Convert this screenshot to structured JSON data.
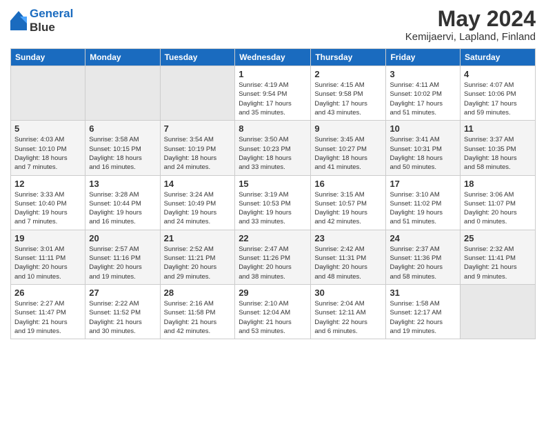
{
  "logo": {
    "line1": "General",
    "line2": "Blue"
  },
  "title": "May 2024",
  "subtitle": "Kemijaervi, Lapland, Finland",
  "weekdays": [
    "Sunday",
    "Monday",
    "Tuesday",
    "Wednesday",
    "Thursday",
    "Friday",
    "Saturday"
  ],
  "weeks": [
    [
      {
        "day": "",
        "info": ""
      },
      {
        "day": "",
        "info": ""
      },
      {
        "day": "",
        "info": ""
      },
      {
        "day": "1",
        "info": "Sunrise: 4:19 AM\nSunset: 9:54 PM\nDaylight: 17 hours\nand 35 minutes."
      },
      {
        "day": "2",
        "info": "Sunrise: 4:15 AM\nSunset: 9:58 PM\nDaylight: 17 hours\nand 43 minutes."
      },
      {
        "day": "3",
        "info": "Sunrise: 4:11 AM\nSunset: 10:02 PM\nDaylight: 17 hours\nand 51 minutes."
      },
      {
        "day": "4",
        "info": "Sunrise: 4:07 AM\nSunset: 10:06 PM\nDaylight: 17 hours\nand 59 minutes."
      }
    ],
    [
      {
        "day": "5",
        "info": "Sunrise: 4:03 AM\nSunset: 10:10 PM\nDaylight: 18 hours\nand 7 minutes."
      },
      {
        "day": "6",
        "info": "Sunrise: 3:58 AM\nSunset: 10:15 PM\nDaylight: 18 hours\nand 16 minutes."
      },
      {
        "day": "7",
        "info": "Sunrise: 3:54 AM\nSunset: 10:19 PM\nDaylight: 18 hours\nand 24 minutes."
      },
      {
        "day": "8",
        "info": "Sunrise: 3:50 AM\nSunset: 10:23 PM\nDaylight: 18 hours\nand 33 minutes."
      },
      {
        "day": "9",
        "info": "Sunrise: 3:45 AM\nSunset: 10:27 PM\nDaylight: 18 hours\nand 41 minutes."
      },
      {
        "day": "10",
        "info": "Sunrise: 3:41 AM\nSunset: 10:31 PM\nDaylight: 18 hours\nand 50 minutes."
      },
      {
        "day": "11",
        "info": "Sunrise: 3:37 AM\nSunset: 10:35 PM\nDaylight: 18 hours\nand 58 minutes."
      }
    ],
    [
      {
        "day": "12",
        "info": "Sunrise: 3:33 AM\nSunset: 10:40 PM\nDaylight: 19 hours\nand 7 minutes."
      },
      {
        "day": "13",
        "info": "Sunrise: 3:28 AM\nSunset: 10:44 PM\nDaylight: 19 hours\nand 16 minutes."
      },
      {
        "day": "14",
        "info": "Sunrise: 3:24 AM\nSunset: 10:49 PM\nDaylight: 19 hours\nand 24 minutes."
      },
      {
        "day": "15",
        "info": "Sunrise: 3:19 AM\nSunset: 10:53 PM\nDaylight: 19 hours\nand 33 minutes."
      },
      {
        "day": "16",
        "info": "Sunrise: 3:15 AM\nSunset: 10:57 PM\nDaylight: 19 hours\nand 42 minutes."
      },
      {
        "day": "17",
        "info": "Sunrise: 3:10 AM\nSunset: 11:02 PM\nDaylight: 19 hours\nand 51 minutes."
      },
      {
        "day": "18",
        "info": "Sunrise: 3:06 AM\nSunset: 11:07 PM\nDaylight: 20 hours\nand 0 minutes."
      }
    ],
    [
      {
        "day": "19",
        "info": "Sunrise: 3:01 AM\nSunset: 11:11 PM\nDaylight: 20 hours\nand 10 minutes."
      },
      {
        "day": "20",
        "info": "Sunrise: 2:57 AM\nSunset: 11:16 PM\nDaylight: 20 hours\nand 19 minutes."
      },
      {
        "day": "21",
        "info": "Sunrise: 2:52 AM\nSunset: 11:21 PM\nDaylight: 20 hours\nand 29 minutes."
      },
      {
        "day": "22",
        "info": "Sunrise: 2:47 AM\nSunset: 11:26 PM\nDaylight: 20 hours\nand 38 minutes."
      },
      {
        "day": "23",
        "info": "Sunrise: 2:42 AM\nSunset: 11:31 PM\nDaylight: 20 hours\nand 48 minutes."
      },
      {
        "day": "24",
        "info": "Sunrise: 2:37 AM\nSunset: 11:36 PM\nDaylight: 20 hours\nand 58 minutes."
      },
      {
        "day": "25",
        "info": "Sunrise: 2:32 AM\nSunset: 11:41 PM\nDaylight: 21 hours\nand 9 minutes."
      }
    ],
    [
      {
        "day": "26",
        "info": "Sunrise: 2:27 AM\nSunset: 11:47 PM\nDaylight: 21 hours\nand 19 minutes."
      },
      {
        "day": "27",
        "info": "Sunrise: 2:22 AM\nSunset: 11:52 PM\nDaylight: 21 hours\nand 30 minutes."
      },
      {
        "day": "28",
        "info": "Sunrise: 2:16 AM\nSunset: 11:58 PM\nDaylight: 21 hours\nand 42 minutes."
      },
      {
        "day": "29",
        "info": "Sunrise: 2:10 AM\nSunset: 12:04 AM\nDaylight: 21 hours\nand 53 minutes."
      },
      {
        "day": "30",
        "info": "Sunrise: 2:04 AM\nSunset: 12:11 AM\nDaylight: 22 hours\nand 6 minutes."
      },
      {
        "day": "31",
        "info": "Sunrise: 1:58 AM\nSunset: 12:17 AM\nDaylight: 22 hours\nand 19 minutes."
      },
      {
        "day": "",
        "info": ""
      }
    ]
  ]
}
